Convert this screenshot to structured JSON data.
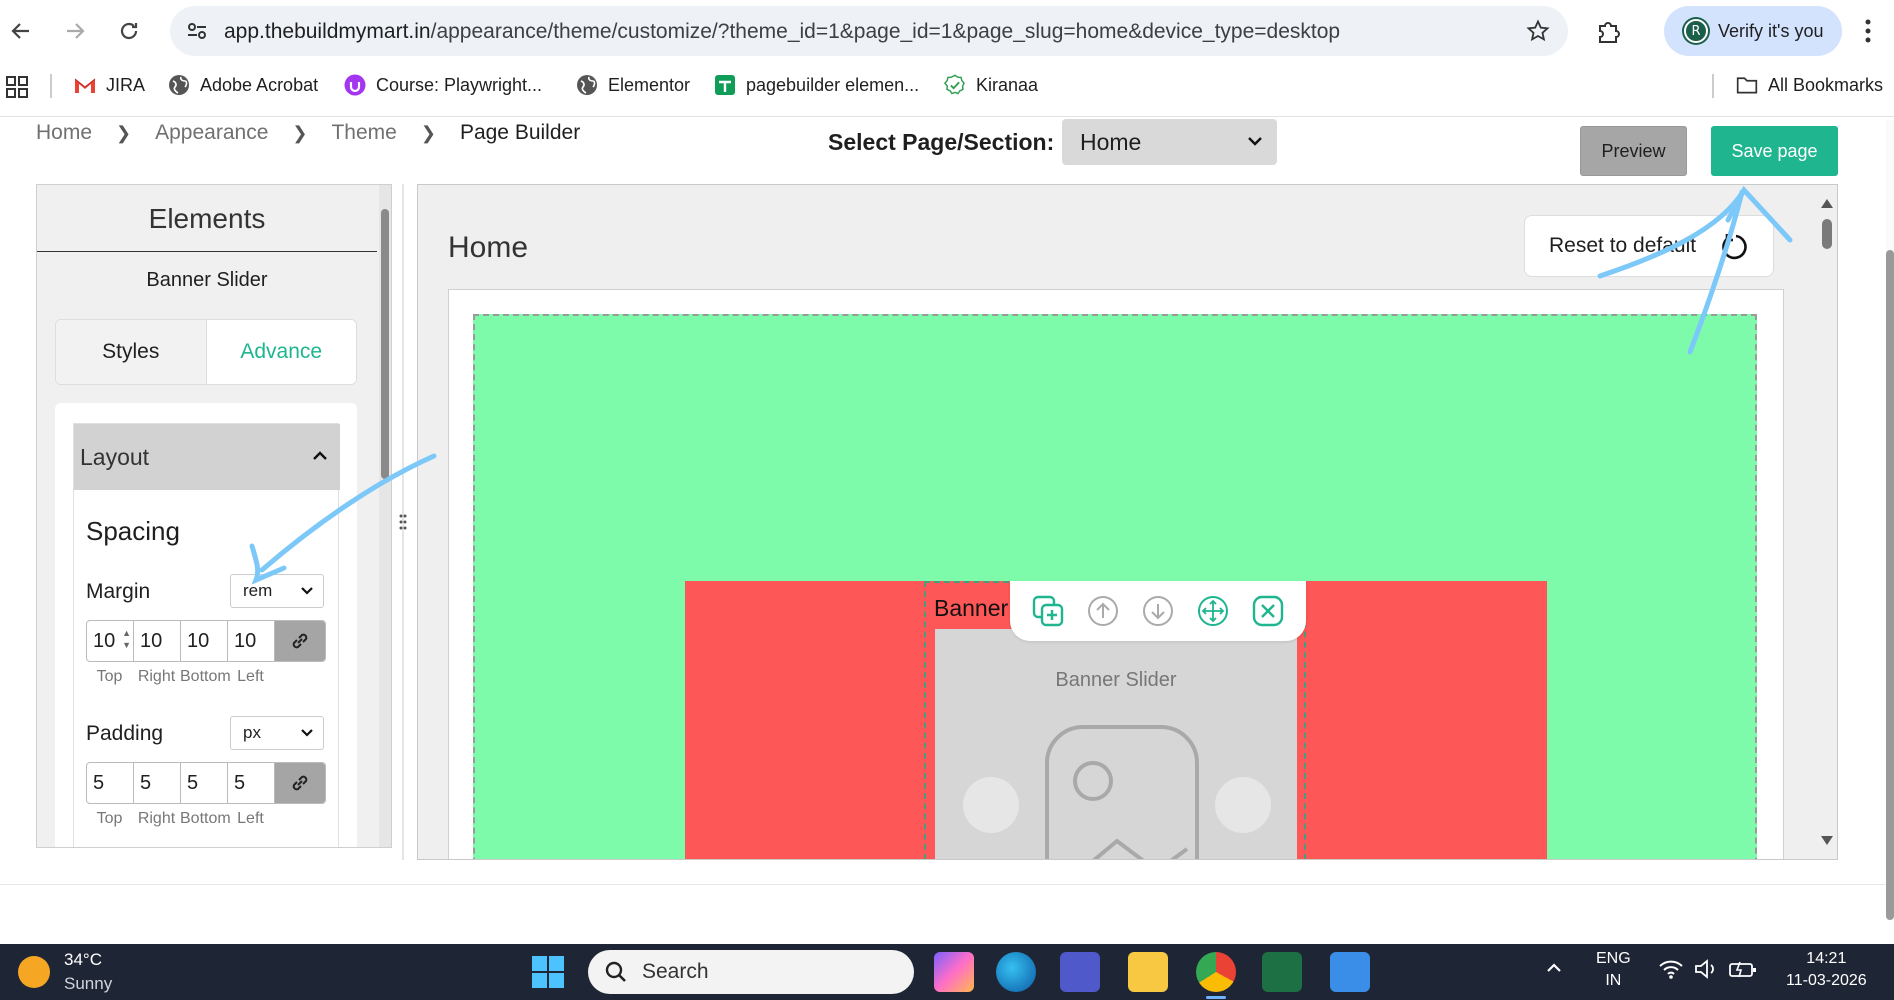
{
  "browser": {
    "url_host": "app.thebuildmymart.in",
    "url_path": "/appearance/theme/customize/?theme_id=1&page_id=1&page_slug=home&device_type=desktop",
    "profile_initial": "R",
    "verify_label": "Verify it's you",
    "bookmarks": [
      {
        "label": "JIRA",
        "icon": "gmail-icon"
      },
      {
        "label": "Adobe Acrobat",
        "icon": "globe-icon"
      },
      {
        "label": "Course: Playwright...",
        "icon": "udemy-icon"
      },
      {
        "label": "Elementor",
        "icon": "globe-icon"
      },
      {
        "label": "pagebuilder elemen...",
        "icon": "sheets-icon"
      },
      {
        "label": "Kiranaa",
        "icon": "check-circle-icon"
      }
    ],
    "all_bookmarks_label": "All Bookmarks"
  },
  "breadcrumb": [
    "Home",
    "Appearance",
    "Theme",
    "Page Builder"
  ],
  "header": {
    "select_label": "Select Page/Section:",
    "selected_page": "Home",
    "preview_label": "Preview",
    "save_label": "Save page"
  },
  "left_panel": {
    "title": "Elements",
    "element_name": "Banner Slider",
    "tabs": [
      {
        "label": "Styles",
        "active": false
      },
      {
        "label": "Advance",
        "active": true
      }
    ],
    "section_title": "Layout",
    "group_title": "Spacing",
    "margin": {
      "label": "Margin",
      "unit": "rem",
      "values": [
        "10",
        "10",
        "10",
        "10"
      ]
    },
    "padding": {
      "label": "Padding",
      "unit": "px",
      "values": [
        "5",
        "5",
        "5",
        "5"
      ]
    },
    "side_labels": [
      "Top",
      "Right",
      "Bottom",
      "Left"
    ]
  },
  "canvas": {
    "title": "Home",
    "reset_label": "Reset to default",
    "slider_label": "Banner",
    "placeholder_title": "Banner Slider"
  },
  "colors": {
    "accent": "#1fb58f",
    "section_bg": "#7efbaa",
    "column_bg": "#fe5757",
    "annotation": "#7cc8f8"
  },
  "taskbar": {
    "temperature": "34°C",
    "weather": "Sunny",
    "search_label": "Search",
    "lang_line1": "ENG",
    "lang_line2": "IN",
    "time": "14:21",
    "date": "11-03-2026"
  }
}
